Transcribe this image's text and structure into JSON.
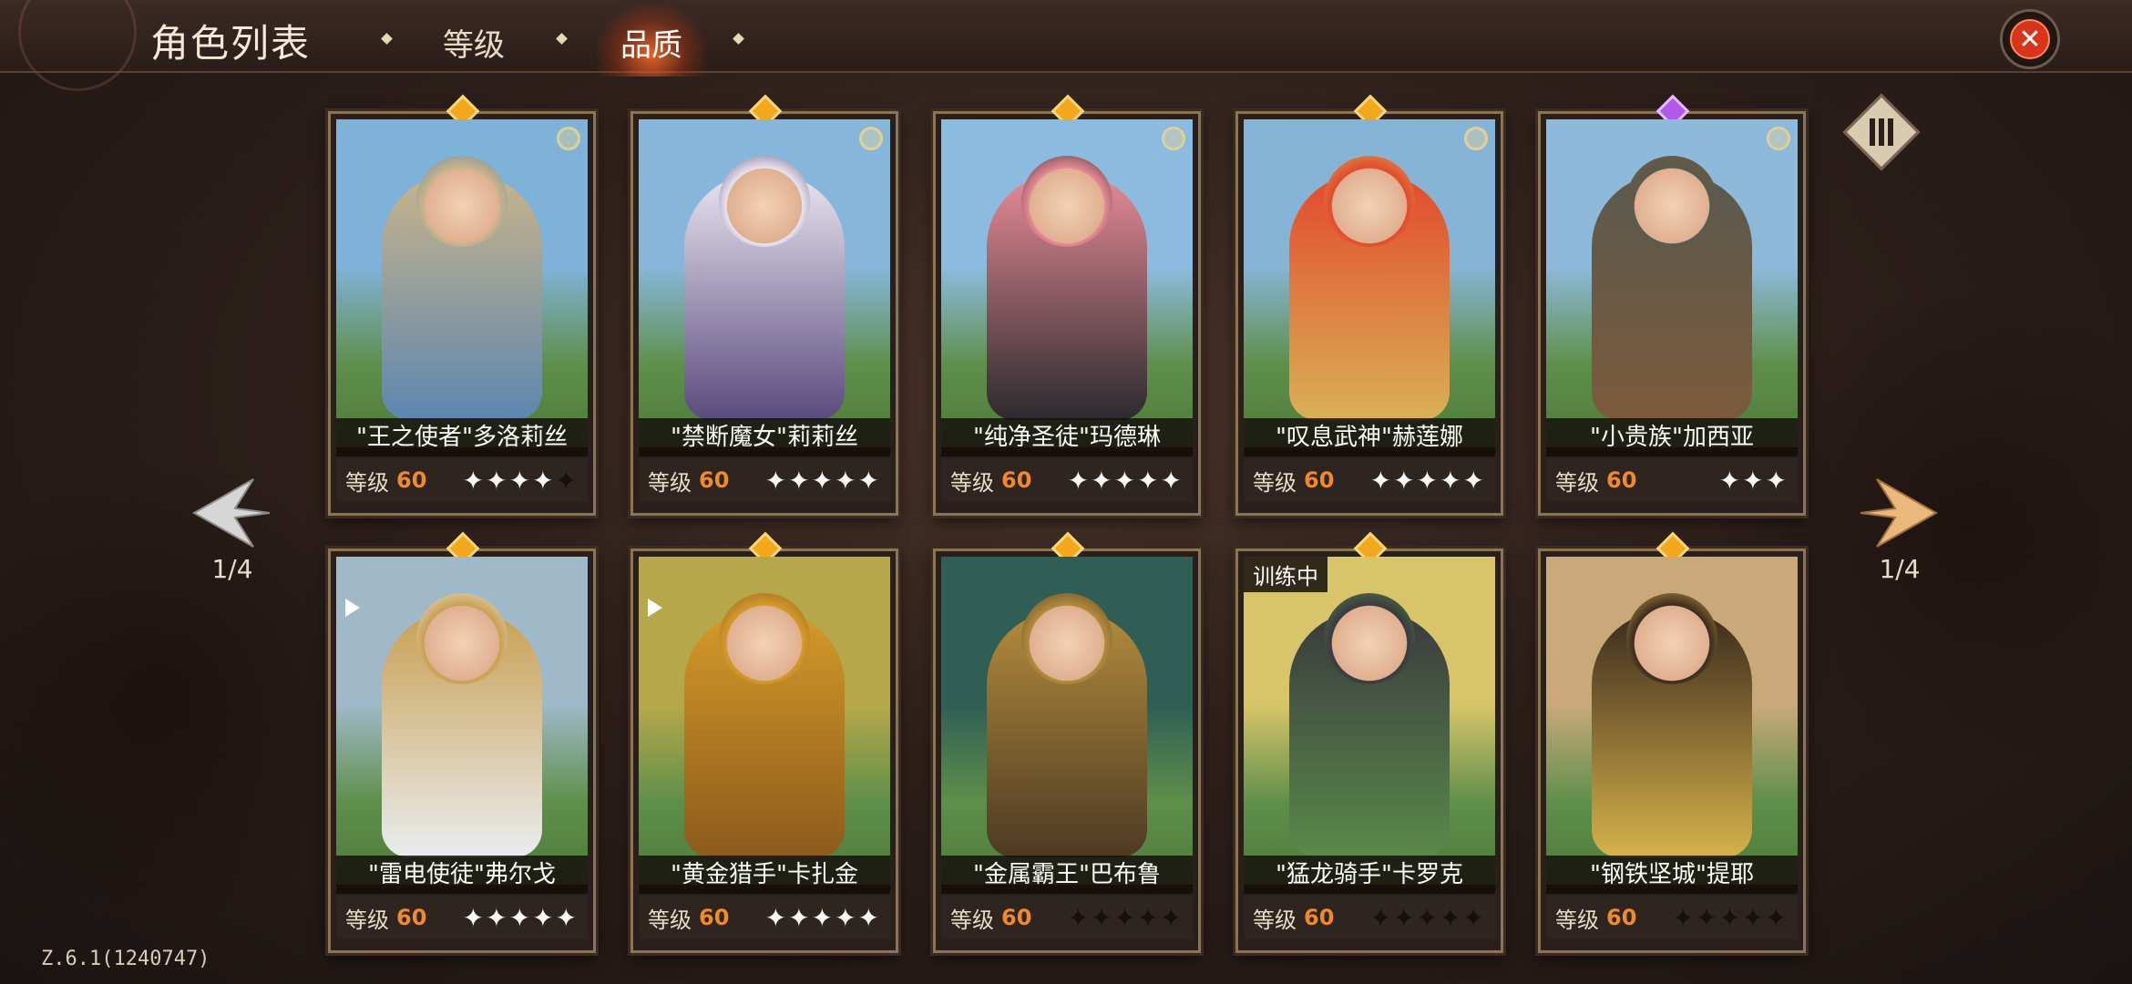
{
  "header": {
    "title": "角色列表",
    "tabs": [
      {
        "label": "等级",
        "active": false
      },
      {
        "label": "品质",
        "active": true
      }
    ],
    "close_icon": "close-icon",
    "accent_color": "#d8331b"
  },
  "pagination": {
    "left": "1/4",
    "right": "1/4"
  },
  "filter_icon": "filter-bars-icon",
  "level_label": "等级",
  "cards": [
    {
      "name": "\"王之使者\"多洛莉丝",
      "level": "60",
      "stars_on": 4,
      "stars_total": 5,
      "gem": "gold",
      "badge": true,
      "training": "",
      "palette": [
        "#7fb2d8",
        "#c8b48a",
        "#5d86b0"
      ]
    },
    {
      "name": "\"禁断魔女\"莉莉丝",
      "level": "60",
      "stars_on": 5,
      "stars_total": 5,
      "gem": "gold",
      "badge": true,
      "training": "",
      "palette": [
        "#86b7da",
        "#e8e4ef",
        "#5a4b7e"
      ]
    },
    {
      "name": "\"纯净圣徒\"玛德琳",
      "level": "60",
      "stars_on": 5,
      "stars_total": 5,
      "gem": "gold",
      "badge": true,
      "training": "",
      "palette": [
        "#8cbbe0",
        "#e78a96",
        "#2b2a2e"
      ]
    },
    {
      "name": "\"叹息武神\"赫莲娜",
      "level": "60",
      "stars_on": 5,
      "stars_total": 5,
      "gem": "gold",
      "badge": true,
      "training": "",
      "palette": [
        "#86b4d6",
        "#e24a2c",
        "#d9b057"
      ]
    },
    {
      "name": "\"小贵族\"加西亚",
      "level": "60",
      "stars_on": 3,
      "stars_total": 3,
      "gem": "purple",
      "badge": true,
      "training": "",
      "palette": [
        "#8db9db",
        "#5a5a4e",
        "#7c5a3b"
      ]
    },
    {
      "name": "\"雷电使徒\"弗尔戈",
      "level": "60",
      "stars_on": 5,
      "stars_total": 5,
      "gem": "gold",
      "badge": false,
      "training": "",
      "palette": [
        "#9fb9c8",
        "#c9a052",
        "#e9ecef"
      ]
    },
    {
      "name": "\"黄金猎手\"卡扎金",
      "level": "60",
      "stars_on": 5,
      "stars_total": 5,
      "gem": "gold",
      "badge": false,
      "training": "",
      "palette": [
        "#b6a84a",
        "#d49a2a",
        "#8c5a1b"
      ]
    },
    {
      "name": "\"金属霸王\"巴布鲁",
      "level": "60",
      "stars_on": 0,
      "stars_total": 5,
      "gem": "gold",
      "badge": false,
      "training": "",
      "palette": [
        "#2f5e55",
        "#b28b3c",
        "#4d3a22"
      ]
    },
    {
      "name": "\"猛龙骑手\"卡罗克",
      "level": "60",
      "stars_on": 0,
      "stars_total": 5,
      "gem": "gold",
      "badge": false,
      "training": "训练中",
      "palette": [
        "#d8c56a",
        "#3a3a3e",
        "#5a8a4a"
      ]
    },
    {
      "name": "\"钢铁坚城\"提耶",
      "level": "60",
      "stars_on": 0,
      "stars_total": 5,
      "gem": "gold",
      "badge": false,
      "training": "",
      "palette": [
        "#c9a97a",
        "#3b2a1e",
        "#d6b24a"
      ]
    }
  ],
  "version": "Z.6.1(1240747)"
}
